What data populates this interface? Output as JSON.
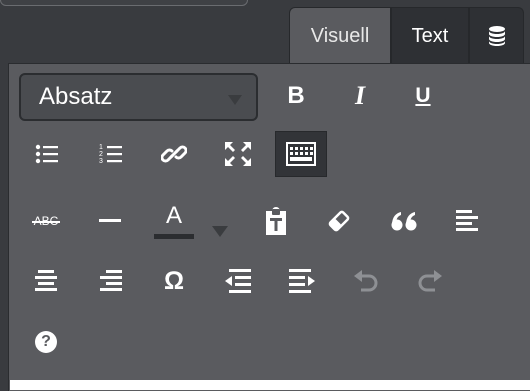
{
  "tabs": [
    {
      "label": "Visuell",
      "active": true
    },
    {
      "label": "Text",
      "active": false
    },
    {
      "icon": "database-icon",
      "active": false
    }
  ],
  "format_select": {
    "value": "Absatz"
  },
  "toolbar": {
    "row1": {
      "bold": {
        "label": "B",
        "icon": "bold-icon"
      },
      "italic": {
        "label": "I",
        "icon": "italic-icon"
      },
      "underline": {
        "label": "U",
        "icon": "underline-icon"
      }
    },
    "row2": [
      "bullet-list-icon",
      "numbered-list-icon",
      "link-icon",
      "fullscreen-icon",
      "toolbar-toggle-icon"
    ],
    "row3": {
      "strikethrough_label": "ABC",
      "text_color_label": "A",
      "icons": [
        "strikethrough-icon",
        "horizontal-line-icon",
        "text-color-icon",
        "dropdown-caret-icon",
        "paste-as-text-icon",
        "clear-formatting-icon",
        "blockquote-icon",
        "align-left-icon"
      ]
    },
    "row4": {
      "special_char_label": "Ω",
      "icons": [
        "align-center-icon",
        "align-right-icon",
        "special-character-icon",
        "outdent-icon",
        "indent-icon",
        "undo-icon",
        "redo-icon"
      ]
    },
    "row5": {
      "help_label": "?",
      "icons": [
        "help-icon"
      ]
    }
  },
  "colors": {
    "background": "#393b3f",
    "panel": "#5a5b5f",
    "inactive_tab": "#2e3034",
    "icon": "#ffffff",
    "disabled_icon": "#8e9094",
    "text_color_underline": "#2b2d30"
  }
}
